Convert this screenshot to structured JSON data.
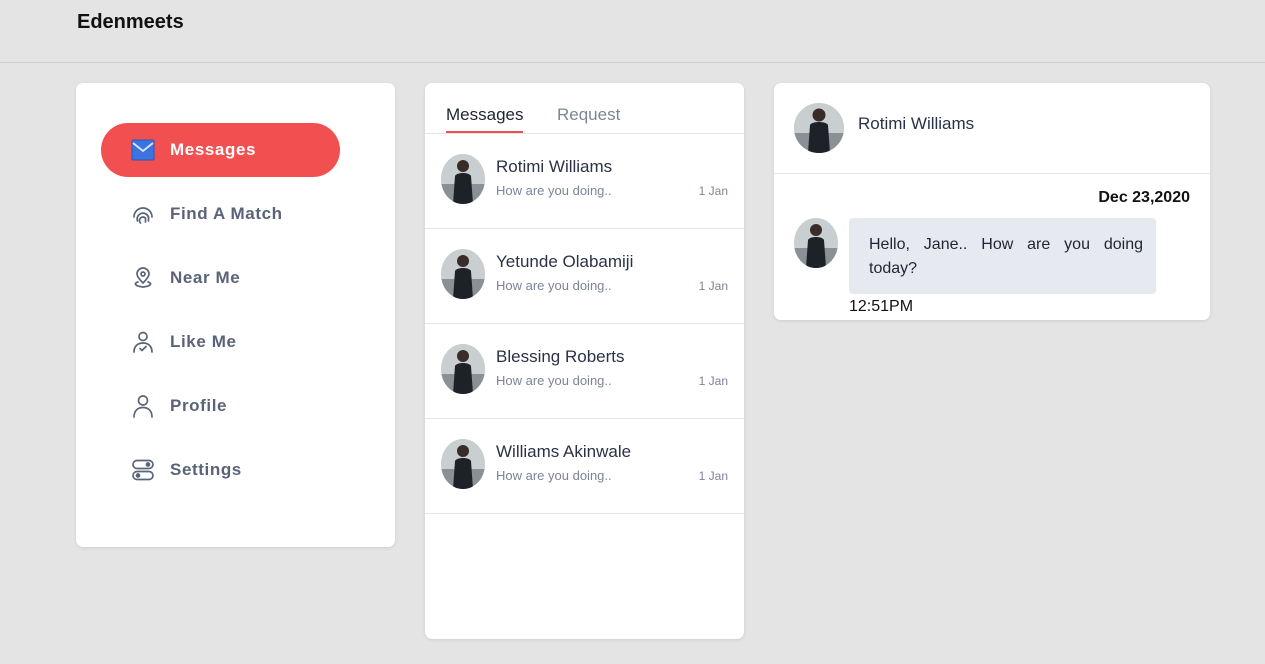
{
  "app": {
    "brand": "Edenmeets"
  },
  "sidebar": {
    "items": [
      {
        "label": "Messages",
        "icon": "envelope-icon",
        "active": true
      },
      {
        "label": "Find A Match",
        "icon": "fingerprint-icon",
        "active": false
      },
      {
        "label": "Near Me",
        "icon": "location-pin-icon",
        "active": false
      },
      {
        "label": "Like Me",
        "icon": "user-check-icon",
        "active": false
      },
      {
        "label": "Profile",
        "icon": "user-icon",
        "active": false
      },
      {
        "label": "Settings",
        "icon": "toggle-settings-icon",
        "active": false
      }
    ]
  },
  "list": {
    "tabs": [
      {
        "label": "Messages",
        "active": true
      },
      {
        "label": "Request",
        "active": false
      }
    ],
    "conversations": [
      {
        "name": "Rotimi Williams",
        "preview": "How are you doing..",
        "date": "1 Jan"
      },
      {
        "name": "Yetunde Olabamiji",
        "preview": "How are you doing..",
        "date": "1 Jan"
      },
      {
        "name": "Blessing Roberts",
        "preview": "How are you doing..",
        "date": "1 Jan"
      },
      {
        "name": "Williams Akinwale",
        "preview": "How are you doing..",
        "date": "1 Jan"
      }
    ]
  },
  "chat": {
    "contact_name": "Rotimi Williams",
    "date": "Dec 23,2020",
    "messages": [
      {
        "text": "Hello, Jane.. How are you doing today?",
        "time": "12:51PM"
      }
    ]
  },
  "colors": {
    "accent": "#f25050",
    "background": "#e4e4e4",
    "nav_text": "#5a6378",
    "bubble": "#e6eaf0",
    "muted_text": "#7c8496"
  }
}
